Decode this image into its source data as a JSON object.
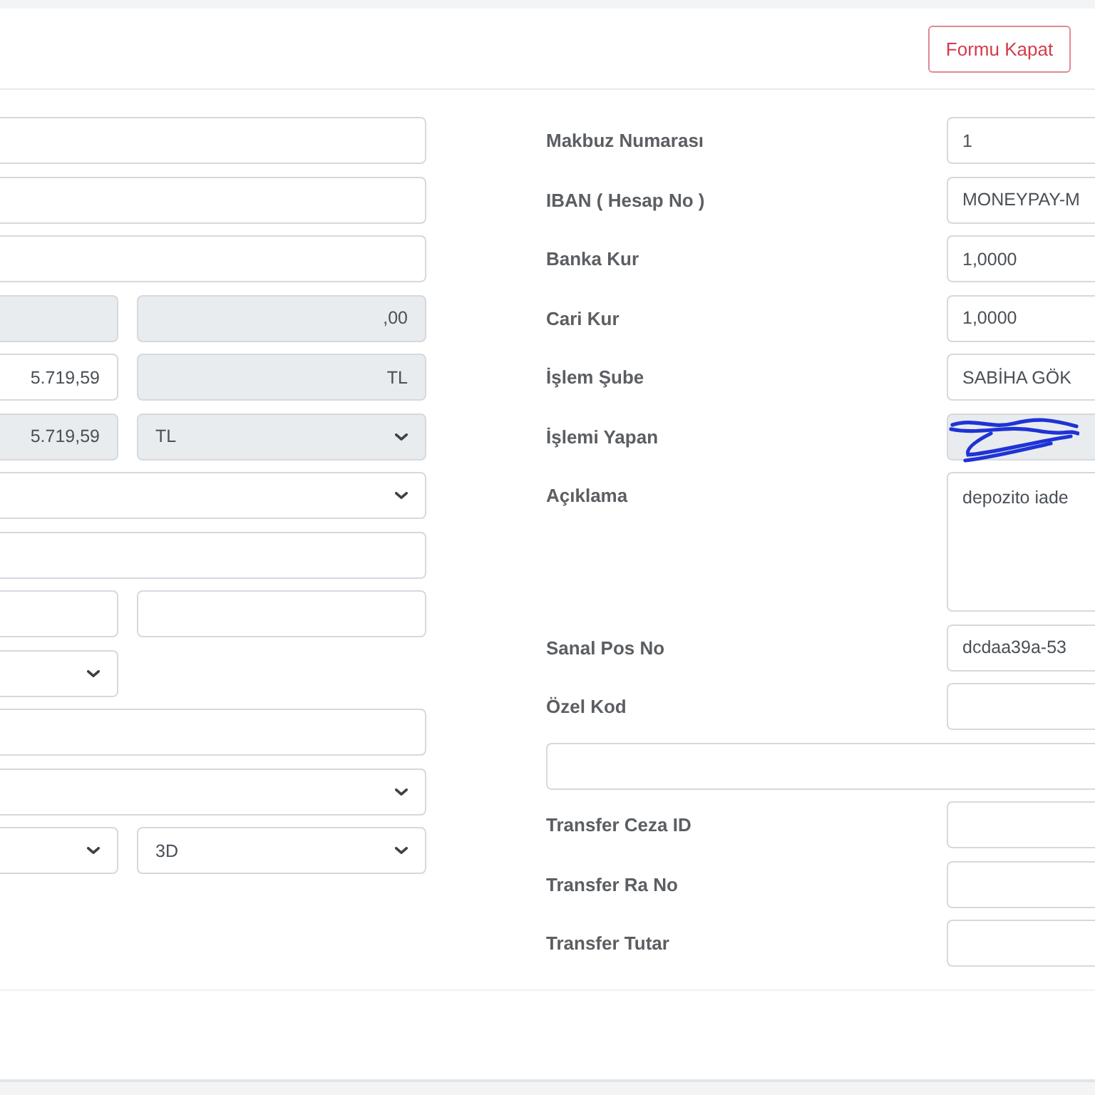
{
  "header": {
    "buttons": [
      {
        "label": "Formu Kapat",
        "kind": "outline-danger"
      }
    ]
  },
  "left_rows": [
    {
      "kind": "single",
      "fields": [
        {
          "kind": "text",
          "disabled": false
        }
      ]
    },
    {
      "kind": "single",
      "fields": [
        {
          "kind": "text",
          "disabled": false
        }
      ]
    },
    {
      "kind": "single",
      "fields": [
        {
          "kind": "text",
          "disabled": false
        }
      ]
    },
    {
      "kind": "pair",
      "fields": [
        {
          "kind": "text",
          "disabled": true
        },
        {
          "kind": "amount",
          "value": ",00",
          "disabled": true
        }
      ]
    },
    {
      "kind": "pair",
      "fields": [
        {
          "kind": "amount",
          "value": "5.719,59",
          "disabled": false
        },
        {
          "kind": "amount",
          "value": "TL",
          "disabled": true
        }
      ]
    },
    {
      "kind": "pair",
      "fields": [
        {
          "kind": "amount",
          "value": "5.719,59",
          "disabled": true
        },
        {
          "kind": "select",
          "value": "TL",
          "disabled": true
        }
      ]
    },
    {
      "kind": "single",
      "fields": [
        {
          "kind": "select",
          "disabled": false
        }
      ]
    },
    {
      "kind": "single",
      "fields": [
        {
          "kind": "text",
          "disabled": false
        }
      ]
    },
    {
      "kind": "pair",
      "fields": [
        {
          "kind": "text",
          "disabled": false
        },
        {
          "kind": "text",
          "disabled": false
        }
      ]
    },
    {
      "kind": "pair",
      "fields": [
        {
          "kind": "select",
          "disabled": false
        }
      ]
    },
    {
      "kind": "single",
      "fields": [
        {
          "kind": "text",
          "disabled": false
        }
      ]
    },
    {
      "kind": "single",
      "fields": [
        {
          "kind": "select",
          "disabled": false
        }
      ]
    },
    {
      "kind": "pair",
      "fields": [
        {
          "kind": "select",
          "disabled": false
        },
        {
          "kind": "select",
          "value": "3D",
          "disabled": false
        }
      ]
    }
  ],
  "right_fields": [
    {
      "label": "Makbuz Numarası",
      "kind": "text",
      "value": "1",
      "disabled": false,
      "redacted": false
    },
    {
      "label": "IBAN ( Hesap No )",
      "kind": "text",
      "value": "MONEYPAY-M",
      "disabled": false,
      "redacted": false
    },
    {
      "label": "Banka Kur",
      "kind": "text",
      "value": "1,0000",
      "disabled": false,
      "redacted": false
    },
    {
      "label": "Cari Kur",
      "kind": "text",
      "value": "1,0000",
      "disabled": false,
      "redacted": false
    },
    {
      "label": "İşlem Şube",
      "kind": "text",
      "value": "SABİHA GÖK",
      "disabled": false,
      "redacted": false
    },
    {
      "label": "İşlemi Yapan",
      "kind": "text",
      "disabled": true,
      "redacted": true
    },
    {
      "label": "Açıklama",
      "kind": "textarea",
      "value": "depozito iade",
      "disabled": false,
      "redacted": false
    },
    {
      "label": "Sanal Pos No",
      "kind": "text",
      "value": "dcdaa39a-53",
      "disabled": false,
      "redacted": false
    },
    {
      "label": "Özel Kod",
      "kind": "text",
      "disabled": false,
      "redacted": false
    },
    {
      "kind": "text",
      "disabled": false,
      "redacted": false
    },
    {
      "label": "Transfer Ceza ID",
      "kind": "text",
      "disabled": false,
      "redacted": false
    },
    {
      "label": "Transfer Ra No",
      "kind": "text",
      "disabled": false,
      "redacted": false
    },
    {
      "label": "Transfer Tutar",
      "kind": "text",
      "disabled": false,
      "redacted": false
    }
  ]
}
